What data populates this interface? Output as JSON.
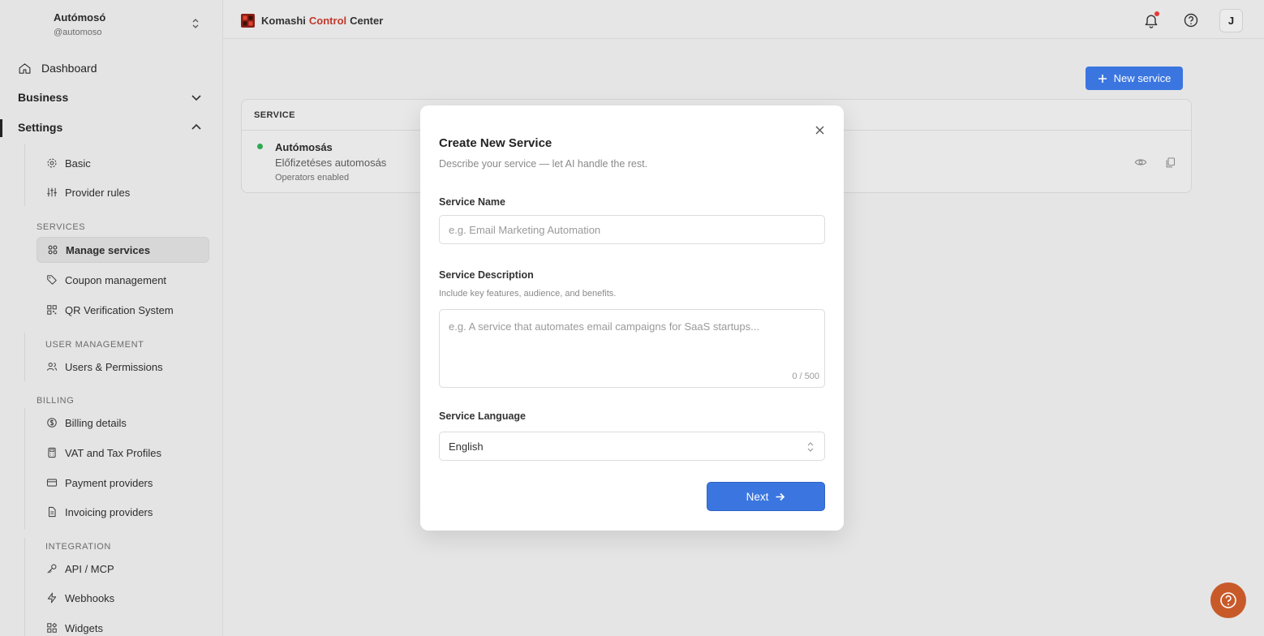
{
  "workspace": {
    "name": "Autómosó",
    "handle": "@automoso"
  },
  "sidebar": {
    "top": [
      {
        "label": "Dashboard"
      },
      {
        "label": "Business"
      },
      {
        "label": "Settings"
      }
    ],
    "settings_items": [
      {
        "label": "Basic"
      },
      {
        "label": "Provider rules"
      }
    ],
    "sections": {
      "services": {
        "title": "SERVICES",
        "items": [
          {
            "label": "Manage services"
          },
          {
            "label": "Coupon management"
          },
          {
            "label": "QR Verification System"
          }
        ]
      },
      "user_management": {
        "title": "USER MANAGEMENT",
        "items": [
          {
            "label": "Users & Permissions"
          }
        ]
      },
      "billing": {
        "title": "BILLING",
        "items": [
          {
            "label": "Billing details"
          },
          {
            "label": "VAT and Tax Profiles"
          },
          {
            "label": "Payment providers"
          },
          {
            "label": "Invoicing providers"
          }
        ]
      },
      "integration": {
        "title": "INTEGRATION",
        "items": [
          {
            "label": "API / MCP"
          },
          {
            "label": "Webhooks"
          },
          {
            "label": "Widgets"
          }
        ]
      }
    }
  },
  "header": {
    "brand_part1": "Komashi",
    "brand_part2": "Control",
    "brand_part3": "Center",
    "avatar_initial": "J"
  },
  "main": {
    "new_service_label": "New service",
    "table": {
      "column_header": "SERVICE",
      "rows": [
        {
          "name": "Autómosás",
          "description": "Előfizetéses automosás",
          "meta": "Operators enabled",
          "status_color": "#2eaa4f"
        }
      ]
    }
  },
  "modal": {
    "title": "Create New Service",
    "subtitle": "Describe your service — let AI handle the rest.",
    "name_label": "Service Name",
    "name_placeholder": "e.g. Email Marketing Automation",
    "name_value": "",
    "desc_label": "Service Description",
    "desc_hint": "Include key features, audience, and benefits.",
    "desc_placeholder": "e.g. A service that automates email campaigns for SaaS startups...",
    "desc_value": "",
    "desc_counter": "0 / 500",
    "lang_label": "Service Language",
    "lang_value": "English",
    "next_label": "Next"
  },
  "colors": {
    "accent": "#3b76e0",
    "brand_red": "#c0392b",
    "notification_dot": "#e53935",
    "help_fab": "#c85a2a"
  }
}
